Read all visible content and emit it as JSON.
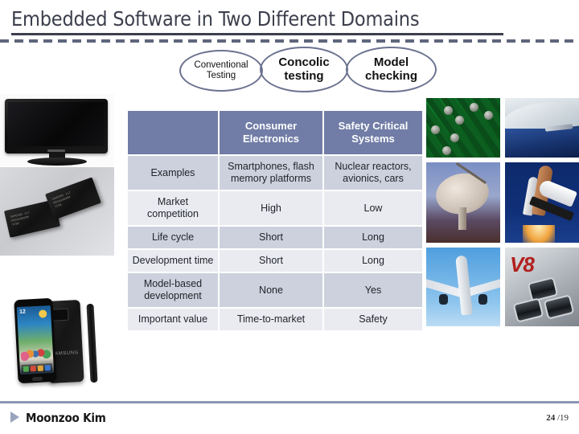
{
  "slide": {
    "title": "Embedded Software in Two Different Domains",
    "author": "Moonzoo Kim",
    "page_current": "24",
    "page_separator": "/",
    "page_total": "19"
  },
  "ellipses": [
    {
      "id": "conventional",
      "line1": "Conventional",
      "line2": "Testing"
    },
    {
      "id": "concolic",
      "line1": "Concolic",
      "line2": "testing"
    },
    {
      "id": "model",
      "line1": "Model",
      "line2": "checking"
    }
  ],
  "table": {
    "headers": [
      "",
      "Consumer Electronics",
      "Safety Critical Systems"
    ],
    "header_cells": {
      "blank": "",
      "consumer_l1": "Consumer",
      "consumer_l2": "Electronics",
      "safety_l1": "Safety Critical",
      "safety_l2": "Systems"
    },
    "rows": [
      {
        "label": "Examples",
        "consumer": "Smartphones, flash memory platforms",
        "safety": "Nuclear reactors, avionics, cars"
      },
      {
        "label": "Market competition",
        "consumer": "High",
        "safety": "Low"
      },
      {
        "label": "Life cycle",
        "consumer": "Short",
        "safety": "Long"
      },
      {
        "label": "Development time",
        "consumer": "Short",
        "safety": "Long"
      },
      {
        "label": "Model-based development",
        "consumer": "None",
        "safety": "Yes"
      },
      {
        "label": "Important value",
        "consumer": "Time-to-market",
        "safety": "Safety"
      }
    ]
  },
  "images": {
    "left": [
      {
        "name": "television",
        "caption": ""
      },
      {
        "name": "flash-memory-chips",
        "caption": ""
      },
      {
        "name": "smartphones",
        "caption": ""
      }
    ],
    "right": [
      {
        "name": "circuit-board",
        "caption": ""
      },
      {
        "name": "car",
        "caption": ""
      },
      {
        "name": "satellite-dish",
        "caption": ""
      },
      {
        "name": "space-shuttle",
        "caption": ""
      },
      {
        "name": "airplane",
        "caption": ""
      },
      {
        "name": "engine",
        "caption": "V8"
      }
    ]
  },
  "colors": {
    "title": "#3c3f4c",
    "header_bg": "#717da6",
    "row_dark": "#ccd1dd",
    "row_light": "#e9ebf0",
    "ellipse_stroke": "#6c7390",
    "footer_rule": "#8c96b4"
  }
}
